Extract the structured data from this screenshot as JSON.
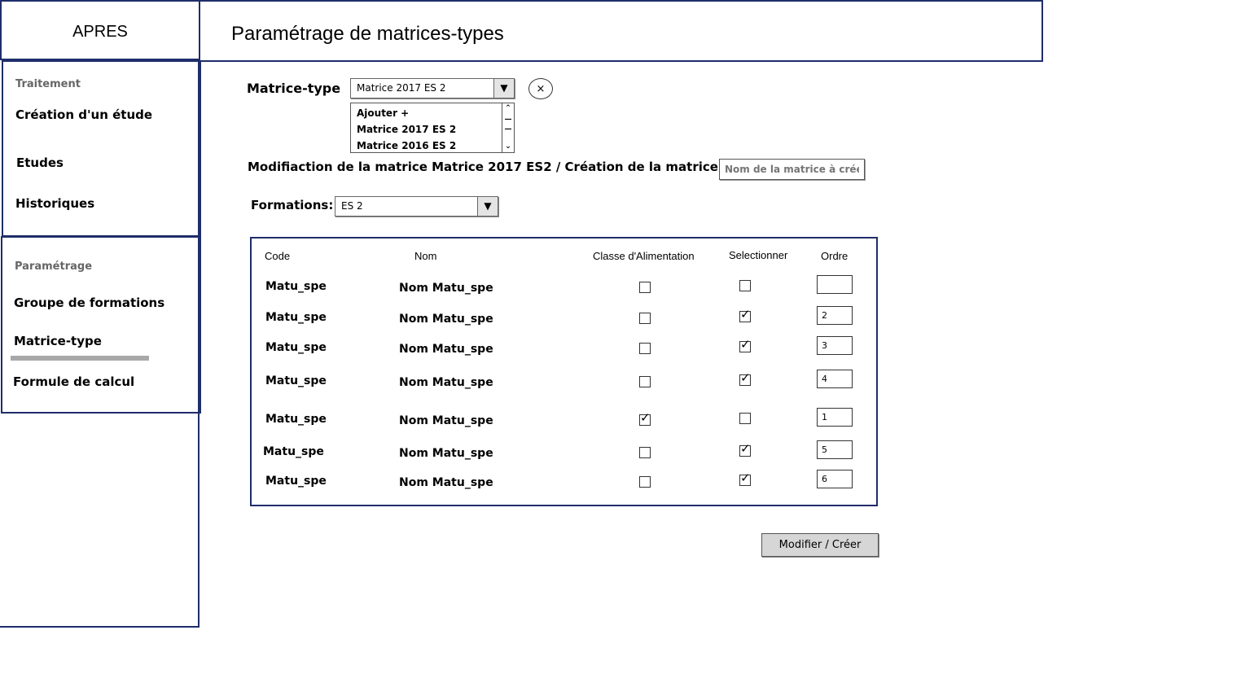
{
  "app": {
    "title": "APRES"
  },
  "header": {
    "title": "Paramétrage de matrices-types"
  },
  "sidebar": {
    "sections": [
      {
        "heading": "Traitement",
        "items": [
          "Création d'un étude",
          "Etudes",
          "Historiques"
        ]
      },
      {
        "heading": "Paramétrage",
        "items": [
          "Groupe de formations",
          "Matrice-type",
          "Formule de calcul"
        ]
      }
    ],
    "active_item": "Matrice-type"
  },
  "form": {
    "matrice_label": "Matrice-type",
    "matrice_selected": "Matrice 2017 ES 2",
    "close_label": "×",
    "dropdown_options": [
      "Ajouter +",
      "Matrice 2017 ES 2",
      "Matrice 2016 ES 2"
    ],
    "modification_text": "Modifiaction de la matrice Matrice 2017 ES2 / Création de la matrice",
    "new_matrix_placeholder": "Nom de la matrice à créer",
    "formations_label": "Formations:",
    "formations_selected": "ES 2"
  },
  "table": {
    "headers": {
      "code": "Code",
      "nom": "Nom",
      "classe": "Classe d'Alimentation",
      "selectionner": "Selectionner",
      "ordre": "Ordre"
    },
    "rows": [
      {
        "code": "Matu_spe",
        "nom": "Nom Matu_spe",
        "classe": false,
        "selectionner": false,
        "ordre": ""
      },
      {
        "code": "Matu_spe",
        "nom": "Nom Matu_spe",
        "classe": false,
        "selectionner": true,
        "ordre": "2"
      },
      {
        "code": "Matu_spe",
        "nom": "Nom Matu_spe",
        "classe": false,
        "selectionner": true,
        "ordre": "3"
      },
      {
        "code": "Matu_spe",
        "nom": "Nom Matu_spe",
        "classe": false,
        "selectionner": true,
        "ordre": "4"
      },
      {
        "code": "Matu_spe",
        "nom": "Nom Matu_spe",
        "classe": true,
        "selectionner": false,
        "ordre": "1"
      },
      {
        "code": "Matu_spe",
        "nom": "Nom Matu_spe",
        "classe": false,
        "selectionner": true,
        "ordre": "5"
      },
      {
        "code": "Matu_spe",
        "nom": "Nom Matu_spe",
        "classe": false,
        "selectionner": true,
        "ordre": "6"
      }
    ]
  },
  "actions": {
    "submit_label": "Modifier / Créer"
  },
  "colors": {
    "border": "#1f2d6b",
    "active_bar": "#a8a8a8",
    "button_bg": "#d6d6d6"
  }
}
